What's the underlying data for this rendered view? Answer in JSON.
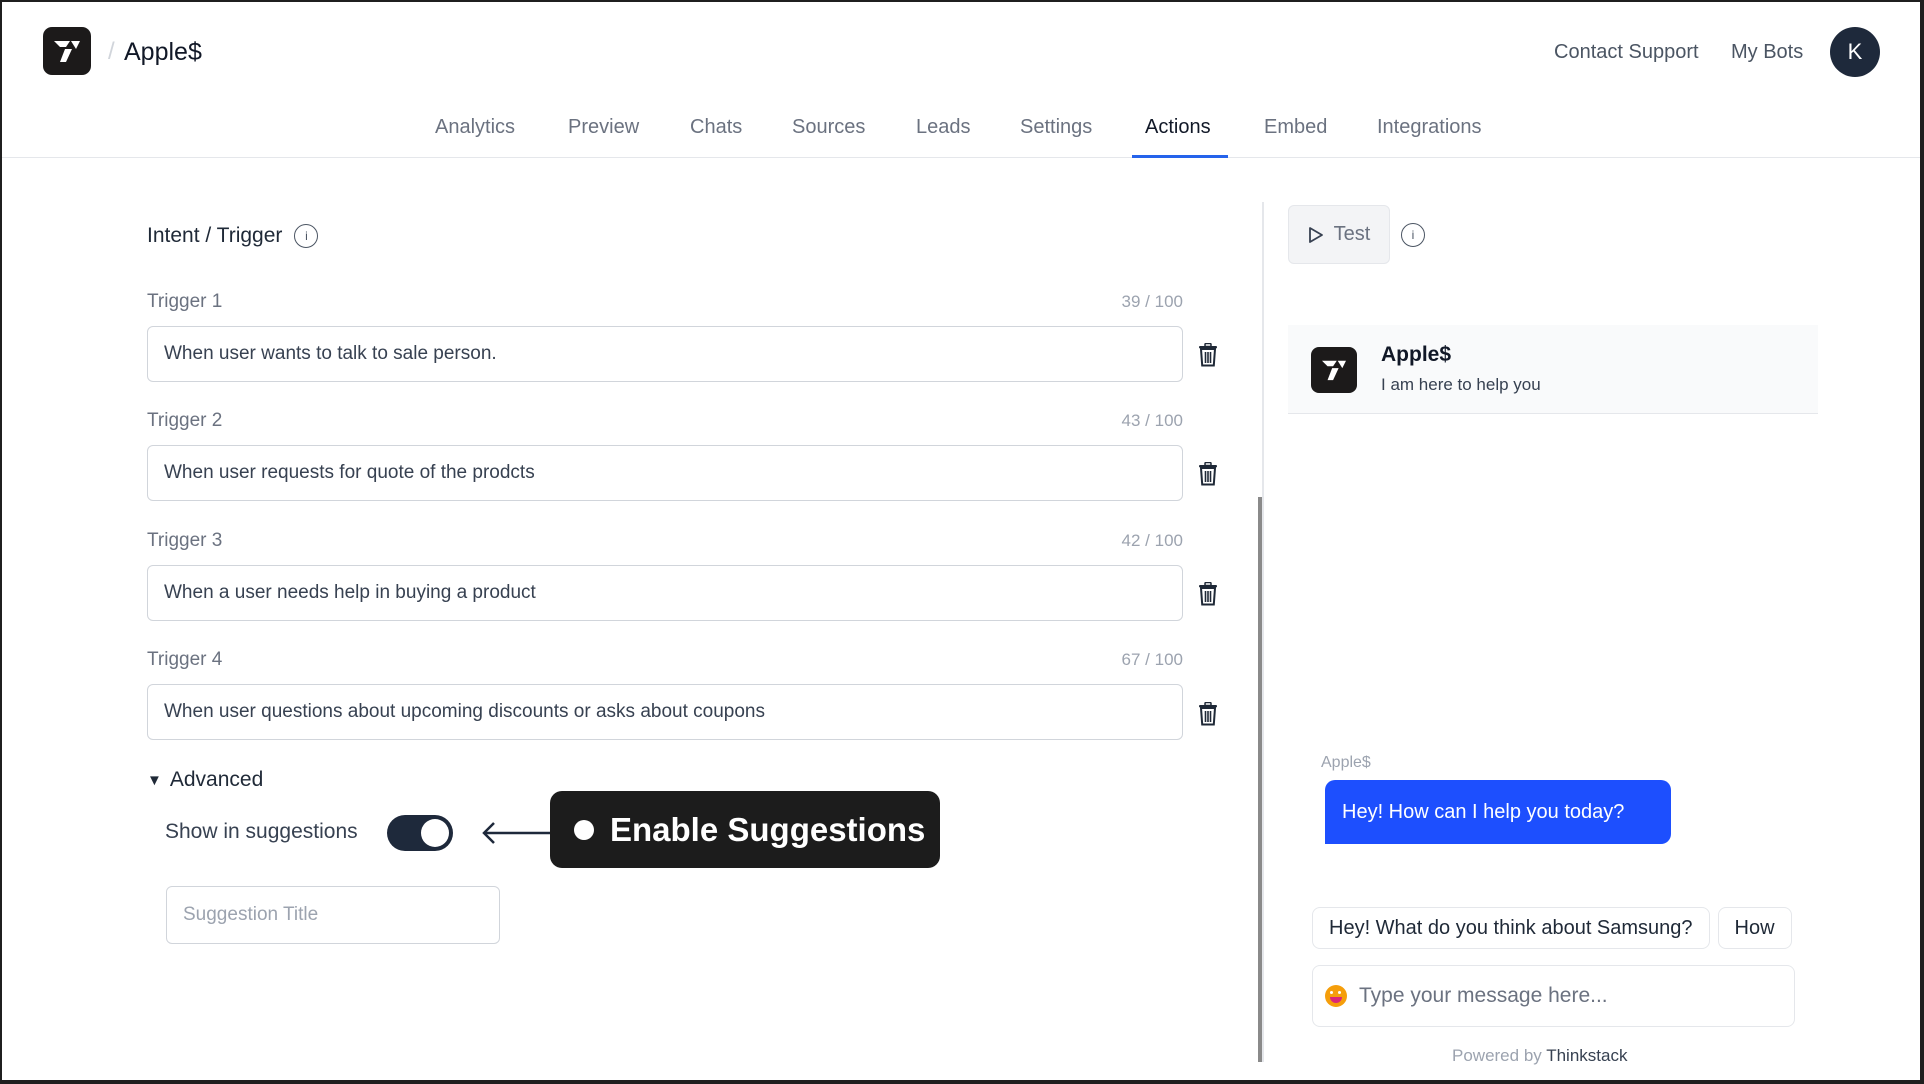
{
  "header": {
    "app_name": "Apple$",
    "breadcrumb_separator": "/",
    "links": [
      "Contact Support",
      "My Bots"
    ],
    "avatar_initial": "K"
  },
  "nav": {
    "tabs": [
      "Analytics",
      "Preview",
      "Chats",
      "Sources",
      "Leads",
      "Settings",
      "Actions",
      "Embed",
      "Integrations"
    ],
    "active": "Actions",
    "accent_color": "#2563eb"
  },
  "form": {
    "section_title": "Intent / Trigger",
    "info_glyph": "i",
    "triggers": [
      {
        "label": "Trigger 1",
        "count": "39 / 100",
        "value": "When user wants to talk to sale person."
      },
      {
        "label": "Trigger 2",
        "count": "43 / 100",
        "value": "When user requests for quote of the prodcts"
      },
      {
        "label": "Trigger 3",
        "count": "42 / 100",
        "value": "When a user needs help in buying a product"
      },
      {
        "label": "Trigger 4",
        "count": "67 / 100",
        "value": "When user questions about upcoming discounts or asks about coupons"
      }
    ],
    "advanced": {
      "label": "Advanced",
      "expanded": true,
      "show_in_suggestions_label": "Show in suggestions",
      "show_in_suggestions": true,
      "suggestion_title_placeholder": "Suggestion Title",
      "suggestion_title_value": ""
    }
  },
  "callout": {
    "text": "Enable Suggestions"
  },
  "preview": {
    "test_label": "Test",
    "bot_name": "Apple$",
    "bot_tagline": "I am here to help you",
    "message_sender": "Apple$",
    "message": "Hey! How can I help you today?",
    "bubble_color": "#1d4ffe",
    "suggestions": [
      "Hey! What do you think about Samsung?",
      "How"
    ],
    "input_placeholder": "Type your message here...",
    "powered_by_prefix": "Powered by",
    "powered_by_brand": "Thinkstack"
  }
}
